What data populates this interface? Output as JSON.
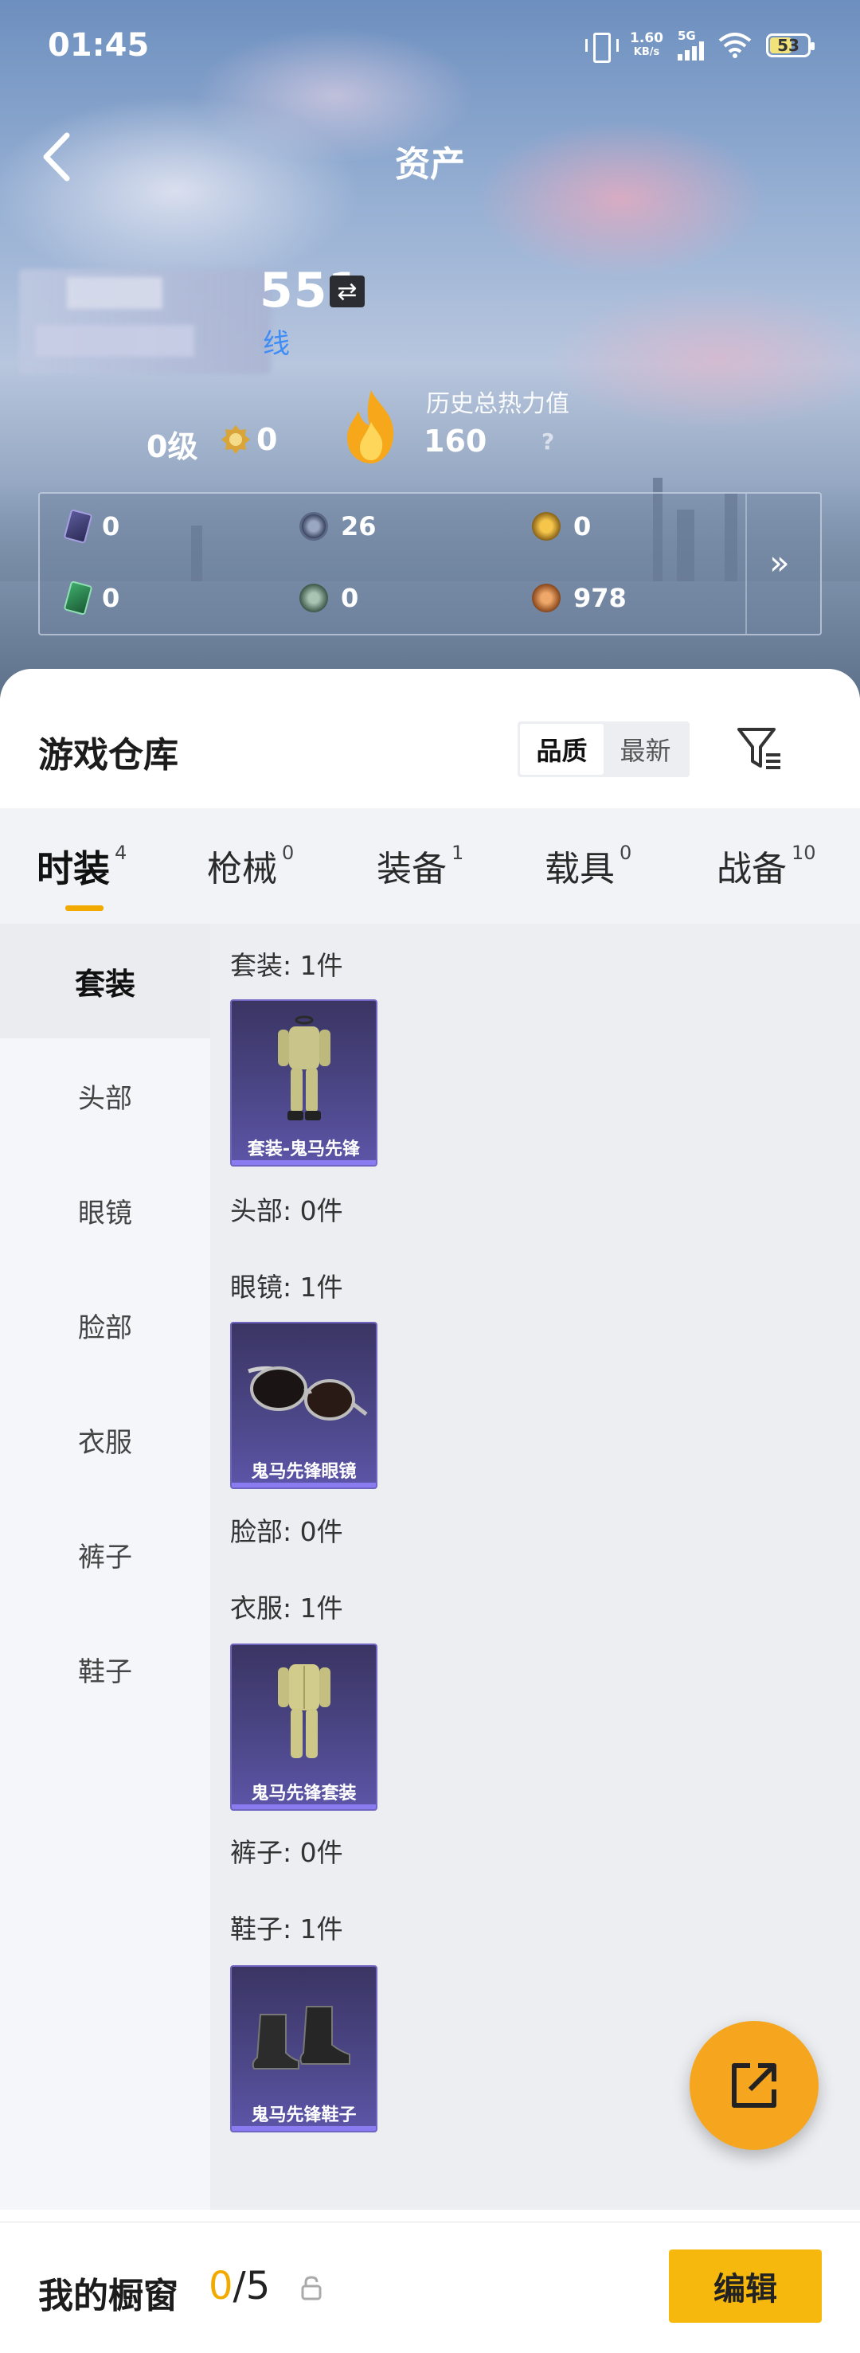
{
  "status_bar": {
    "time": "01:45",
    "net_speed_value": "1.60",
    "net_speed_unit": "KB/s",
    "network_type": "5G",
    "battery": "53"
  },
  "header": {
    "title": "资产",
    "player_id_fragment": "551",
    "blue_fragment": "线"
  },
  "stats": {
    "level": "0级",
    "medal_count": "0",
    "heat_label": "历史总热力值",
    "heat_value": "160",
    "help": "?"
  },
  "currencies": [
    {
      "icon": "purple-card-icon",
      "value": "0"
    },
    {
      "icon": "silver-coin-icon",
      "value": "26"
    },
    {
      "icon": "gold-token-icon",
      "value": "0"
    },
    {
      "icon": "green-card-icon",
      "value": "0"
    },
    {
      "icon": "green-coin-icon",
      "value": "0"
    },
    {
      "icon": "bronze-coin-icon",
      "value": "978"
    }
  ],
  "warehouse": {
    "title": "游戏仓库",
    "sort_options": [
      "品质",
      "最新"
    ],
    "sort_selected": "品质"
  },
  "tabs": [
    {
      "label": "时装",
      "count": "4",
      "active": true
    },
    {
      "label": "枪械",
      "count": "0"
    },
    {
      "label": "装备",
      "count": "1"
    },
    {
      "label": "载具",
      "count": "0"
    },
    {
      "label": "战备",
      "count": "10"
    }
  ],
  "sidebar": [
    {
      "label": "套装",
      "active": true
    },
    {
      "label": "头部"
    },
    {
      "label": "眼镜"
    },
    {
      "label": "脸部"
    },
    {
      "label": "衣服"
    },
    {
      "label": "裤子"
    },
    {
      "label": "鞋子"
    }
  ],
  "sections": [
    {
      "label": "套装: 1件",
      "item": "套装-鬼马先锋"
    },
    {
      "label": "头部: 0件"
    },
    {
      "label": "眼镜: 1件",
      "item": "鬼马先锋眼镜"
    },
    {
      "label": "脸部: 0件"
    },
    {
      "label": "衣服: 1件",
      "item": "鬼马先锋套装"
    },
    {
      "label": "裤子: 0件"
    },
    {
      "label": "鞋子: 1件",
      "item": "鬼马先锋鞋子"
    }
  ],
  "showcase": {
    "label": "我的橱窗",
    "current": "0",
    "total": "/5",
    "edit_label": "编辑"
  },
  "colors": {
    "accent": "#f6b80d",
    "fab": "#f6a61e",
    "card_bg": "#4b4686"
  }
}
